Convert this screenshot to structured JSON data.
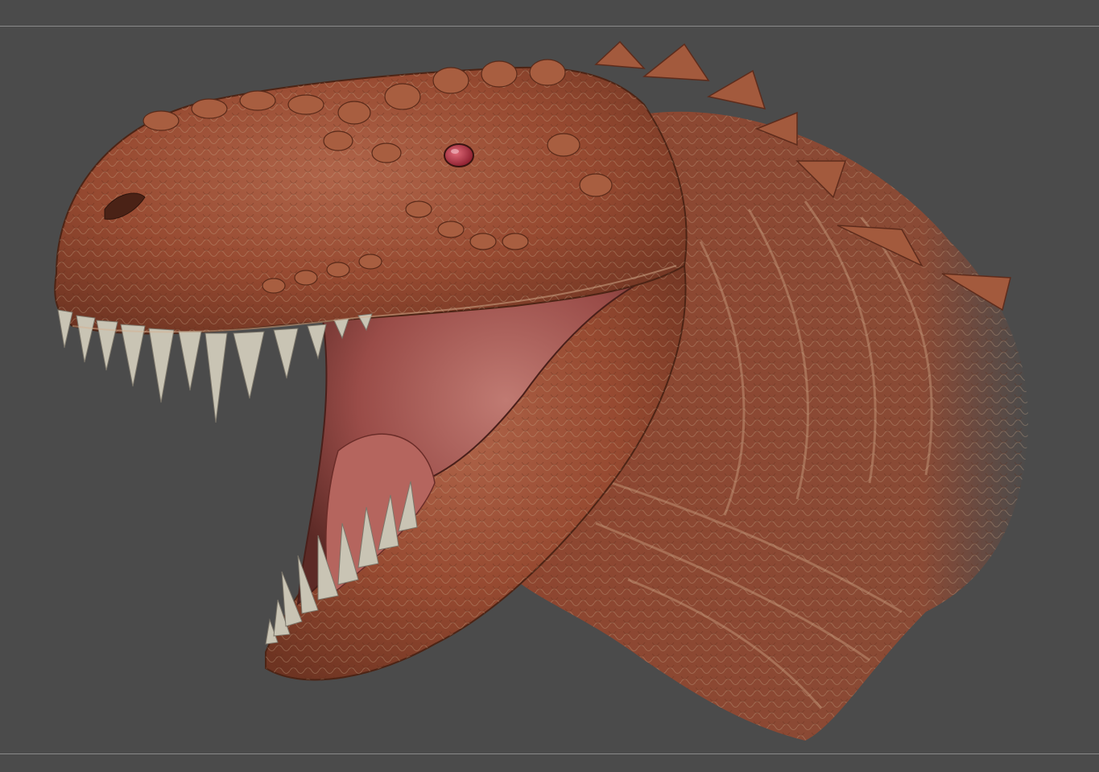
{
  "scene": {
    "subject": "dinosaur-head-sculpt",
    "background_color": "#4b4b4b",
    "frame_line_color": "#8a8a8a",
    "skin_color": "#9b4f35",
    "skin_highlight": "#b8896a",
    "mouth_color": "#a85656",
    "teeth_color": "#c9c4b4",
    "eye_color": "#c03a4a"
  }
}
